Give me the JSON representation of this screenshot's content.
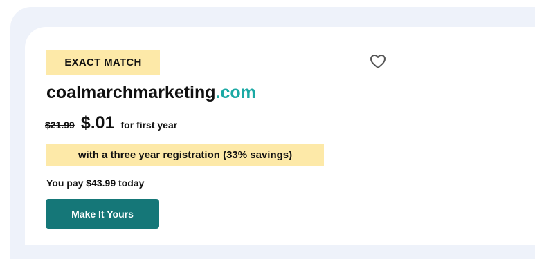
{
  "badge": {
    "label": "EXACT MATCH"
  },
  "favorite": {
    "icon": "heart-outline-icon",
    "color": "#555555"
  },
  "domain": {
    "name": "coalmarchmarketing",
    "tld": ".com",
    "tld_color": "#1ba9a4"
  },
  "pricing": {
    "original_price": "$21.99",
    "sale_price": "$.01",
    "term_note": "for first year"
  },
  "promo": {
    "text": "with a three year registration (33% savings)",
    "background": "#fde9a8"
  },
  "total": {
    "text": "You pay $43.99 today"
  },
  "cta": {
    "label": "Make It Yours",
    "background": "#157778"
  }
}
